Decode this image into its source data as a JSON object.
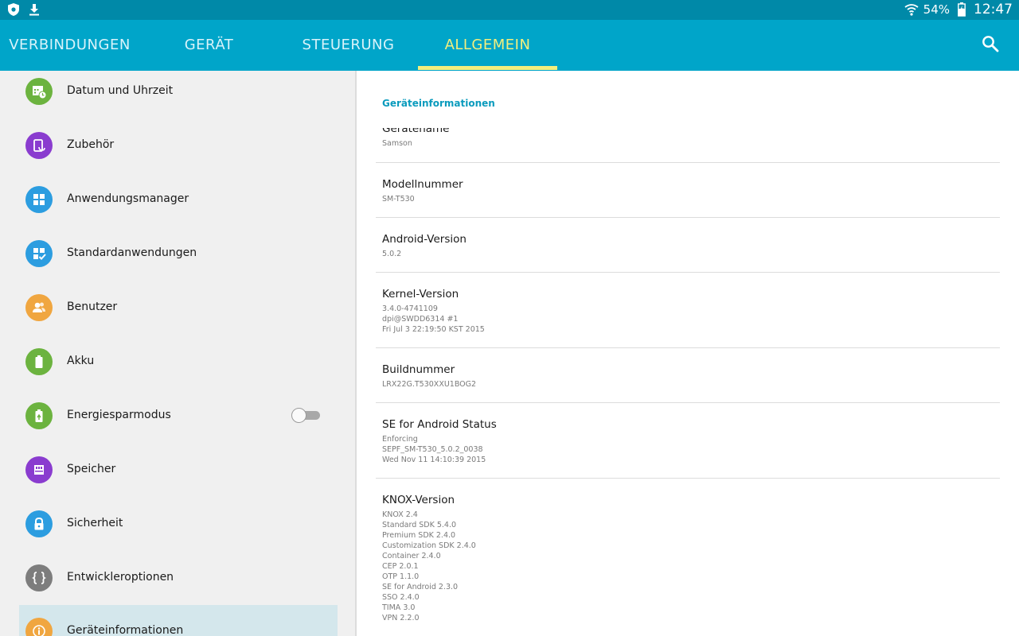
{
  "status_bar": {
    "left_icons": [
      "shield-icon",
      "download-icon"
    ],
    "battery_percent": "54%",
    "time": "12:47",
    "colors": {
      "background": "#0089a8"
    }
  },
  "tabs": [
    {
      "label": "VERBINDUNGEN",
      "active": false
    },
    {
      "label": "GERÄT",
      "active": false
    },
    {
      "label": "STEUERUNG",
      "active": false
    },
    {
      "label": "ALLGEMEIN",
      "active": true
    }
  ],
  "tabbar": {
    "search_icon": "search-icon",
    "colors": {
      "background": "#00a5c9",
      "active": "#f3ef7d",
      "inactive": "#d9f3fa"
    }
  },
  "sidebar": {
    "items": [
      {
        "label": "Datum und Uhrzeit",
        "icon": "calendar-clock-icon",
        "color": "#6cb33f"
      },
      {
        "label": "Zubehör",
        "icon": "accessory-icon",
        "color": "#8a3ccf"
      },
      {
        "label": "Anwendungsmanager",
        "icon": "apps-grid-icon",
        "color": "#2c9de0"
      },
      {
        "label": "Standardanwendungen",
        "icon": "default-apps-icon",
        "color": "#2c9de0"
      },
      {
        "label": "Benutzer",
        "icon": "users-icon",
        "color": "#f0a640"
      },
      {
        "label": "Akku",
        "icon": "battery-icon",
        "color": "#6cb33f"
      },
      {
        "label": "Energiesparmodus",
        "icon": "power-saving-icon",
        "color": "#6cb33f",
        "toggle": false
      },
      {
        "label": "Speicher",
        "icon": "storage-icon",
        "color": "#8a3ccf"
      },
      {
        "label": "Sicherheit",
        "icon": "lock-icon",
        "color": "#2c9de0"
      },
      {
        "label": "Entwickleroptionen",
        "icon": "developer-braces-icon",
        "color": "#7d7d7d"
      },
      {
        "label": "Geräteinformationen",
        "icon": "info-icon",
        "color": "#f0a640",
        "selected": true
      }
    ]
  },
  "detail": {
    "section_header": "Geräteinformationen",
    "clipped_item": {
      "title": "Gerätename",
      "value": "Samson"
    },
    "items": [
      {
        "title": "Modellnummer",
        "lines": [
          "SM-T530"
        ]
      },
      {
        "title": "Android-Version",
        "lines": [
          "5.0.2"
        ]
      },
      {
        "title": "Kernel-Version",
        "lines": [
          "3.4.0-4741109",
          "dpi@SWDD6314 #1",
          "Fri Jul 3 22:19:50 KST 2015"
        ]
      },
      {
        "title": "Buildnummer",
        "lines": [
          "LRX22G.T530XXU1BOG2"
        ]
      },
      {
        "title": "SE for Android Status",
        "lines": [
          "Enforcing",
          "SEPF_SM-T530_5.0.2_0038",
          "Wed Nov 11 14:10:39 2015"
        ]
      },
      {
        "title": "KNOX-Version",
        "lines": [
          "KNOX 2.4",
          "Standard SDK 5.4.0",
          "Premium SDK 2.4.0",
          "Customization SDK 2.4.0",
          "Container 2.4.0",
          "CEP 2.0.1",
          "OTP 1.1.0",
          "SE for Android 2.3.0",
          "SSO 2.4.0",
          "TIMA 3.0",
          "VPN 2.2.0"
        ]
      }
    ]
  }
}
